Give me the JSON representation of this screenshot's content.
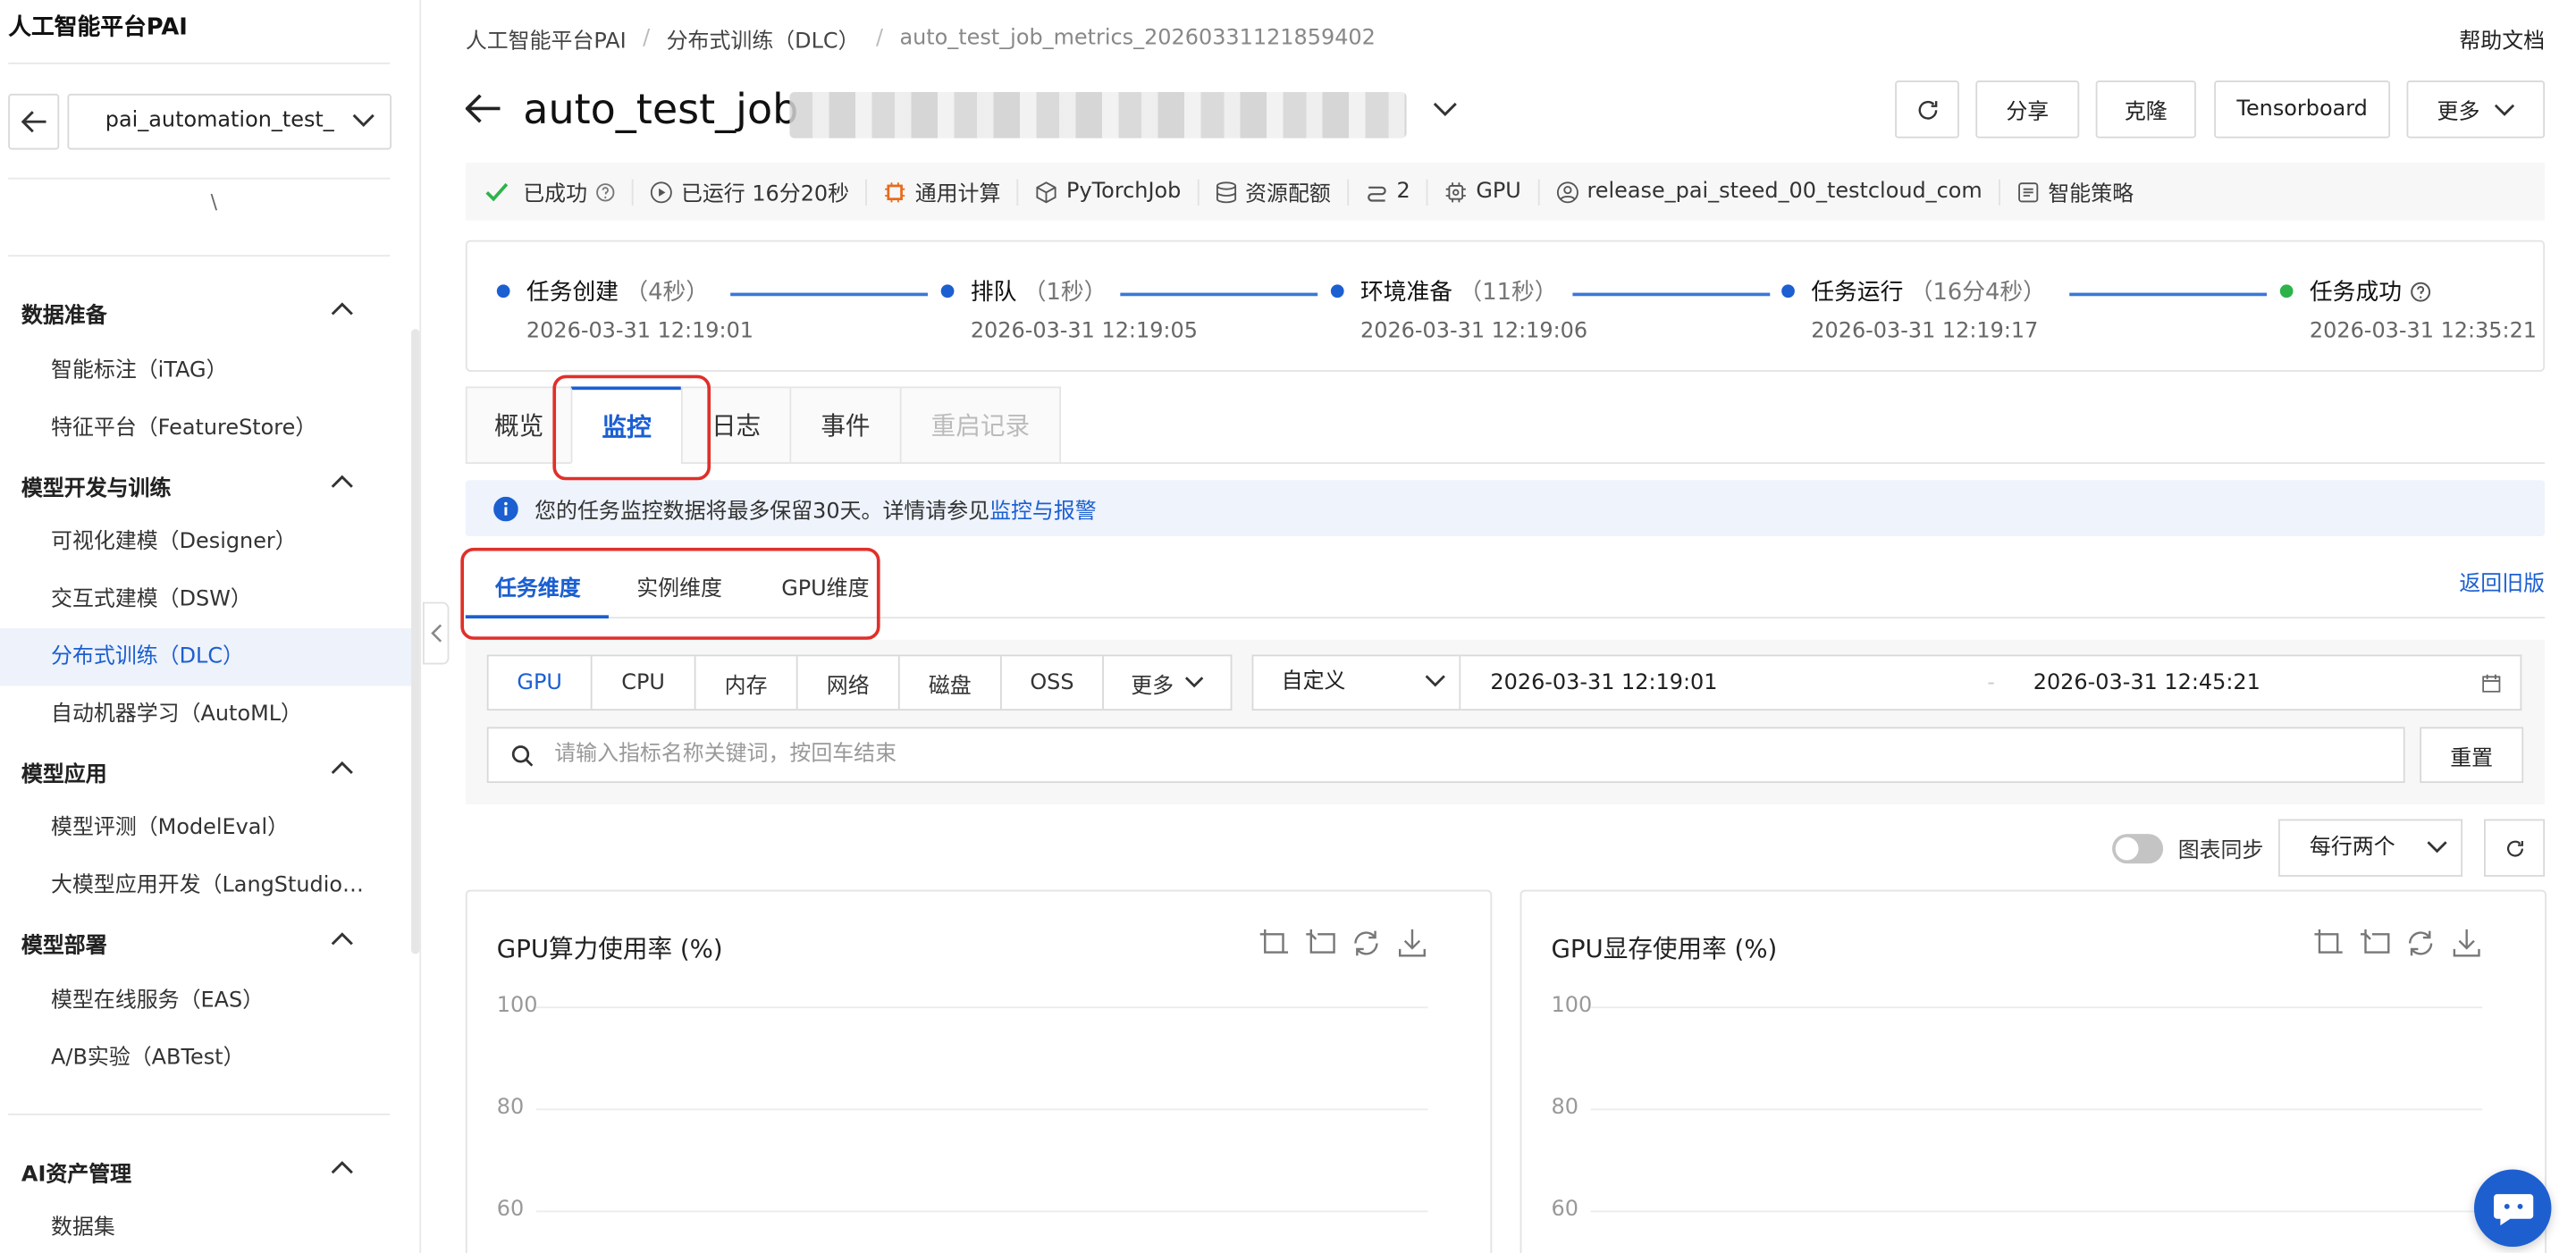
{
  "sidebar": {
    "brand": "人工智能平台PAI",
    "workspace": "pai_automation_test_",
    "cut_text": "\\",
    "groups": [
      {
        "label": "数据准备",
        "items": [
          "智能标注（iTAG）",
          "特征平台（FeatureStore）"
        ]
      },
      {
        "label": "模型开发与训练",
        "items": [
          "可视化建模（Designer）",
          "交互式建模（DSW）",
          "分布式训练（DLC）",
          "自动机器学习（AutoML）"
        ]
      },
      {
        "label": "模型应用",
        "items": [
          "模型评测（ModelEval）",
          "大模型应用开发（LangStudio…"
        ]
      },
      {
        "label": "模型部署",
        "items": [
          "模型在线服务（EAS）",
          "A/B实验（ABTest）"
        ]
      },
      {
        "label": "AI资产管理",
        "items": [
          "数据集"
        ]
      }
    ],
    "active_item": "分布式训练（DLC）"
  },
  "header": {
    "breadcrumb": [
      "人工智能平台PAI",
      "分布式训练（DLC）",
      "auto_test_job_metrics_20260331121859402"
    ],
    "help": "帮助文档",
    "title": "auto_test_job",
    "buttons": {
      "share": "分享",
      "clone": "克隆",
      "tensorboard": "Tensorboard",
      "more": "更多"
    }
  },
  "meta": {
    "status": "已成功",
    "runtime": "已运行 16分20秒",
    "compute": "通用计算",
    "job_type": "PyTorchJob",
    "resource": "资源配额",
    "nodes": "2",
    "gpu": "GPU",
    "user": "release_pai_steed_00_testcloud_com",
    "policy": "智能策略"
  },
  "steps": [
    {
      "name": "任务创建",
      "duration": "（4秒）",
      "time": "2026-03-31 12:19:01"
    },
    {
      "name": "排队",
      "duration": "（1秒）",
      "time": "2026-03-31 12:19:05"
    },
    {
      "name": "环境准备",
      "duration": "（11秒）",
      "time": "2026-03-31 12:19:06"
    },
    {
      "name": "任务运行",
      "duration": "（16分4秒）",
      "time": "2026-03-31 12:19:17"
    },
    {
      "name": "任务成功",
      "duration": "",
      "time": "2026-03-31 12:35:21"
    }
  ],
  "tabs": [
    "概览",
    "监控",
    "日志",
    "事件",
    "重启记录"
  ],
  "notice": {
    "text": "您的任务监控数据将最多保留30天。详情请参见",
    "link": "监控与报警"
  },
  "subtabs": [
    "任务维度",
    "实例维度",
    "GPU维度"
  ],
  "old_version": "返回旧版",
  "filters": {
    "metric_tabs": [
      "GPU",
      "CPU",
      "内存",
      "网络",
      "磁盘",
      "OSS",
      "更多"
    ],
    "range_mode": "自定义",
    "start": "2026-03-31 12:19:01",
    "end": "2026-03-31 12:45:21",
    "search_placeholder": "请输入指标名称关键词，按回车结束",
    "reset": "重置"
  },
  "chart_sync": "图表同步",
  "per_row": "每行两个",
  "charts": [
    {
      "title": "GPU算力使用率 (%)",
      "yticks": [
        "100",
        "80",
        "60"
      ]
    },
    {
      "title": "GPU显存使用率 (%)",
      "yticks": [
        "100",
        "80",
        "60"
      ]
    }
  ],
  "colors": {
    "accent": "#1b5fd1",
    "success": "#2db34a",
    "highlight": "#e0302a"
  }
}
